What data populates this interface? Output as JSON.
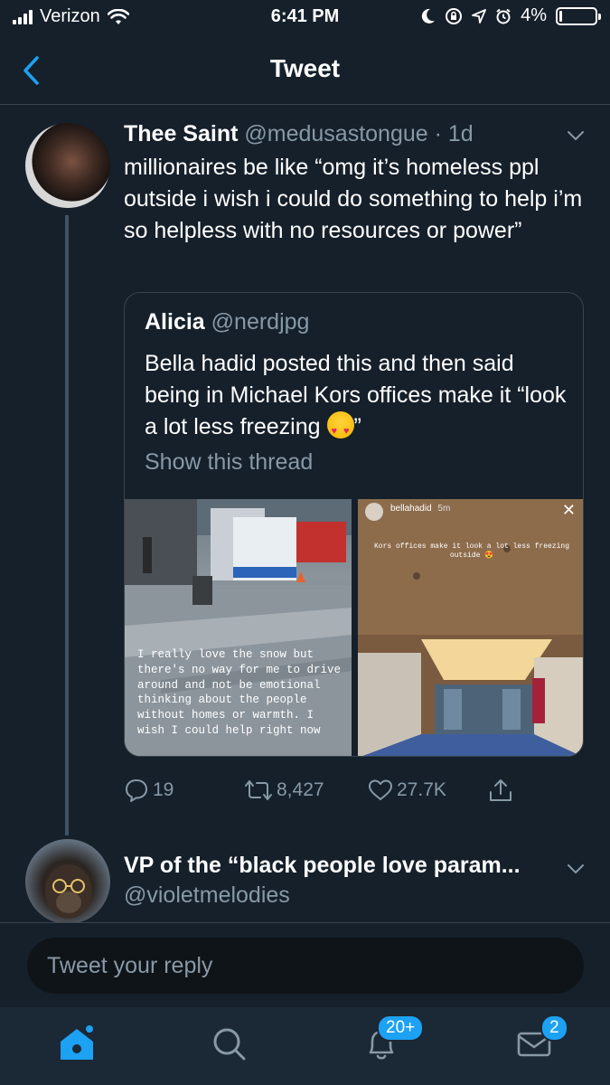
{
  "status_bar": {
    "carrier": "Verizon",
    "time": "6:41 PM",
    "battery": "4%",
    "battery_level": 0.04
  },
  "nav": {
    "title": "Tweet",
    "back_icon": "chevron-left-icon"
  },
  "tweet": {
    "name": "Thee Saint",
    "handle": "@medusastongue",
    "time": "· 1d",
    "text": "millionaires be like “omg it’s homeless ppl outside i wish i could do something to help i’m so helpless with no resources or power”",
    "quote": {
      "name": "Alicia",
      "handle": "@nerdjpg",
      "text_before": "Bella hadid posted this and then said being in Michael Kors offices make it “look a lot less freezing ",
      "text_after": "”",
      "show_thread": "Show this thread",
      "image_left_text": "I really love the snow but there's no way for me to drive around and not be emotional thinking about the people without homes or warmth. I wish I could help right now",
      "image_right_user": "bellahadid",
      "image_right_time": "5m",
      "image_right_caption": "Kors offices make it look a lot less freezing outside 😍"
    },
    "actions": {
      "replies": "19",
      "retweets": "8,427",
      "likes": "27.7K"
    }
  },
  "tweet2": {
    "name": "VP of the “black people love param...",
    "handle": "@violetmelodies"
  },
  "reply": {
    "placeholder": "Tweet your reply"
  },
  "tab_bar": {
    "notifications_badge": "20+",
    "messages_badge": "2"
  },
  "colors": {
    "background": "#15202b",
    "accent": "#1da1f2",
    "secondary_text": "#8899a6",
    "border": "#38444d"
  }
}
